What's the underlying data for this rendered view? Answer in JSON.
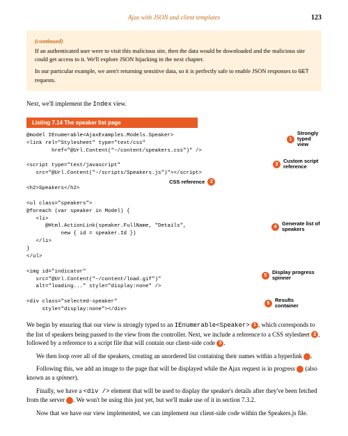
{
  "header": {
    "title": "Ajax with JSON and client templates",
    "page": "123"
  },
  "callout": {
    "label": "(continued)",
    "p1": "If an authenticated user were to visit this malicious site, then the data would be downloaded and the malicious site could get access to it. We'll explore JSON hijacking in the next chapter.",
    "p2_a": "In our particular example, we aren't returning sensitive data, so it is perfectly safe to enable JSON responses to ",
    "p2_get": "GET",
    "p2_b": " requests."
  },
  "intro": {
    "a": "Next, we'll implement the ",
    "code": "Index",
    "b": " view."
  },
  "listing": {
    "label": "Listing 7.14   The speaker list page"
  },
  "code_lines": {
    "l1": "@model IEnumerable<AjaxExamples.Models.Speaker>",
    "l2": "<link rel=\"Stylesheet\" type=\"text/css\"",
    "l3": "        href=\"@Url.Content(\"~/content/speakers.css\")\" />",
    "l4": "",
    "l5": "<script type=\"text/javascript\"",
    "l6": "   src=\"@Url.Content(\"~/scripts/Speakers.js\")\"></script>",
    "l7": "",
    "l8": "<h2>Speakers</h2>",
    "l9": "",
    "l10": "<ul class=\"speakers\">",
    "l11": "@foreach (var speaker in Model) {",
    "l12": "   <li>",
    "l13": "      @Html.ActionLink(speaker.FullName, \"Details\",",
    "l14": "           new { id = speaker.Id })",
    "l15": "   </li>",
    "l16": "}",
    "l17": "</ul>",
    "l18": "",
    "l19": "<img id=\"indicator\"",
    "l20": "   src=\"@Url.Content(\"~/content/load.gif\")\"",
    "l21": "   alt=\"loading...\" style=\"display:none\" />",
    "l22": "",
    "l23": "<div class=\"selected-speaker\"",
    "l24": "     style=\"display:none\"></div>"
  },
  "annotations": {
    "a1": "Strongly typed view",
    "a2": "CSS reference",
    "a3": "Custom script reference",
    "a4": "Generate list of speakers",
    "a5": "Display progress spinner",
    "a6": "Results container"
  },
  "para": {
    "p1a": "We begin by ensuring that our view is strongly typed to an ",
    "p1code": "IEnumerable<Speaker>",
    "p1b": ", which corresponds to the list of speakers being passed to the view from the controller. Next, we include a reference to a CSS stylesheet ",
    "p1c": ", followed by a reference to a script file that will contain our client-side code ",
    "p1d": ".",
    "p2a": "We then loop over all of the speakers, creating an unordered list containing their names within a hyperlink ",
    "p2b": ".",
    "p3a": "Following this, we add an image to the page that will be displayed while the Ajax request is in progress ",
    "p3b": " (also known as a ",
    "p3i": "spinner",
    "p3c": ").",
    "p4a": "Finally, we have a ",
    "p4code": "<div />",
    "p4b": " element that will be used to display the speaker's details after they've been fetched from the server ",
    "p4c": ". We won't be using this just yet, but we'll make use of it in section 7.3.2.",
    "p5": "Now that we have our view implemented, we can implement our client-side code within the Speakers.js file."
  },
  "cues": {
    "c1": "1",
    "c2": "2",
    "c3": "3",
    "c4": "4",
    "c5": "5",
    "c6": "6"
  }
}
